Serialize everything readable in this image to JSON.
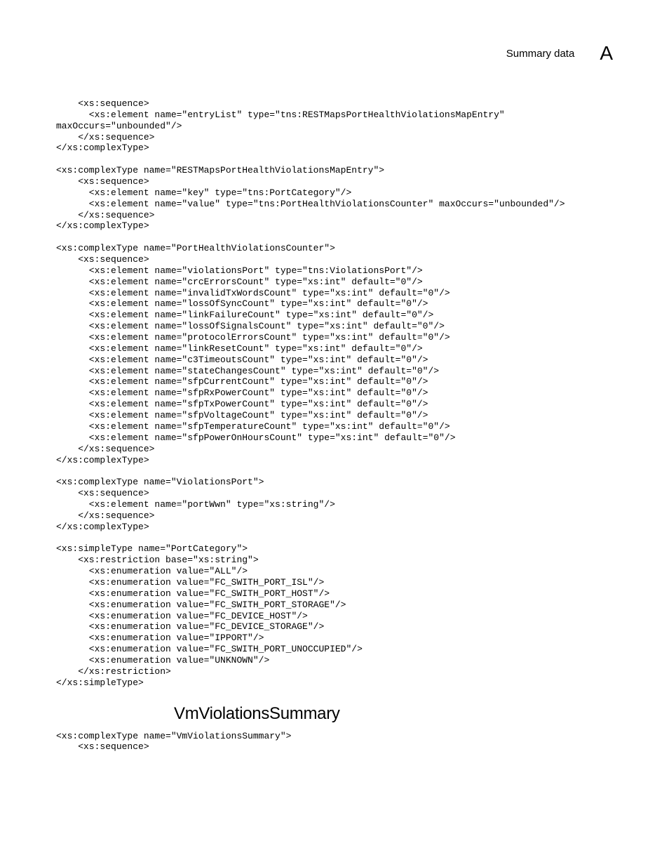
{
  "header": {
    "title": "Summary data",
    "section_letter": "A"
  },
  "code_block_1": "    <xs:sequence>\n      <xs:element name=\"entryList\" type=\"tns:RESTMapsPortHealthViolationsMapEntry\" \nmaxOccurs=\"unbounded\"/>\n    </xs:sequence>\n</xs:complexType>\n\n<xs:complexType name=\"RESTMapsPortHealthViolationsMapEntry\">\n    <xs:sequence>\n      <xs:element name=\"key\" type=\"tns:PortCategory\"/>\n      <xs:element name=\"value\" type=\"tns:PortHealthViolationsCounter\" maxOccurs=\"unbounded\"/>\n    </xs:sequence>\n</xs:complexType>\n\n<xs:complexType name=\"PortHealthViolationsCounter\">\n    <xs:sequence>\n      <xs:element name=\"violationsPort\" type=\"tns:ViolationsPort\"/>\n      <xs:element name=\"crcErrorsCount\" type=\"xs:int\" default=\"0\"/>\n      <xs:element name=\"invalidTxWordsCount\" type=\"xs:int\" default=\"0\"/>\n      <xs:element name=\"lossOfSyncCount\" type=\"xs:int\" default=\"0\"/>\n      <xs:element name=\"linkFailureCount\" type=\"xs:int\" default=\"0\"/>\n      <xs:element name=\"lossOfSignalsCount\" type=\"xs:int\" default=\"0\"/>\n      <xs:element name=\"protocolErrorsCount\" type=\"xs:int\" default=\"0\"/>\n      <xs:element name=\"linkResetCount\" type=\"xs:int\" default=\"0\"/>\n      <xs:element name=\"c3TimeoutsCount\" type=\"xs:int\" default=\"0\"/>\n      <xs:element name=\"stateChangesCount\" type=\"xs:int\" default=\"0\"/>\n      <xs:element name=\"sfpCurrentCount\" type=\"xs:int\" default=\"0\"/>\n      <xs:element name=\"sfpRxPowerCount\" type=\"xs:int\" default=\"0\"/>\n      <xs:element name=\"sfpTxPowerCount\" type=\"xs:int\" default=\"0\"/>\n      <xs:element name=\"sfpVoltageCount\" type=\"xs:int\" default=\"0\"/>\n      <xs:element name=\"sfpTemperatureCount\" type=\"xs:int\" default=\"0\"/>\n      <xs:element name=\"sfpPowerOnHoursCount\" type=\"xs:int\" default=\"0\"/>\n    </xs:sequence>\n</xs:complexType>\n\n<xs:complexType name=\"ViolationsPort\">\n    <xs:sequence>\n      <xs:element name=\"portWwn\" type=\"xs:string\"/>\n    </xs:sequence>\n</xs:complexType>\n\n<xs:simpleType name=\"PortCategory\">\n    <xs:restriction base=\"xs:string\">\n      <xs:enumeration value=\"ALL\"/>\n      <xs:enumeration value=\"FC_SWITH_PORT_ISL\"/>\n      <xs:enumeration value=\"FC_SWITH_PORT_HOST\"/>\n      <xs:enumeration value=\"FC_SWITH_PORT_STORAGE\"/>\n      <xs:enumeration value=\"FC_DEVICE_HOST\"/>\n      <xs:enumeration value=\"FC_DEVICE_STORAGE\"/>\n      <xs:enumeration value=\"IPPORT\"/>\n      <xs:enumeration value=\"FC_SWITH_PORT_UNOCCUPIED\"/>\n      <xs:enumeration value=\"UNKNOWN\"/>\n    </xs:restriction>\n</xs:simpleType>",
  "section_heading": "VmViolationsSummary",
  "code_block_2": "<xs:complexType name=\"VmViolationsSummary\">\n    <xs:sequence>"
}
